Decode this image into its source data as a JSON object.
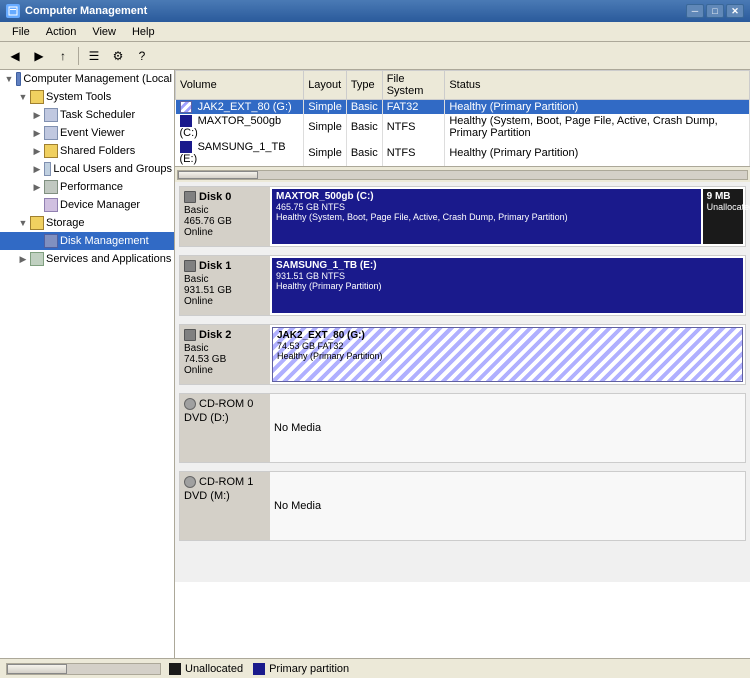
{
  "titleBar": {
    "title": "Computer Management",
    "windowControls": [
      "_",
      "□",
      "✕"
    ]
  },
  "menuBar": {
    "items": [
      "File",
      "Action",
      "View",
      "Help"
    ]
  },
  "sidebar": {
    "root": "Computer Management (Local",
    "items": [
      {
        "id": "system-tools",
        "label": "System Tools",
        "indent": 1,
        "expanded": true
      },
      {
        "id": "task-scheduler",
        "label": "Task Scheduler",
        "indent": 2
      },
      {
        "id": "event-viewer",
        "label": "Event Viewer",
        "indent": 2
      },
      {
        "id": "shared-folders",
        "label": "Shared Folders",
        "indent": 2
      },
      {
        "id": "local-users",
        "label": "Local Users and Groups",
        "indent": 2
      },
      {
        "id": "performance",
        "label": "Performance",
        "indent": 2
      },
      {
        "id": "device-manager",
        "label": "Device Manager",
        "indent": 2
      },
      {
        "id": "storage",
        "label": "Storage",
        "indent": 1,
        "expanded": true
      },
      {
        "id": "disk-management",
        "label": "Disk Management",
        "indent": 2,
        "selected": true
      },
      {
        "id": "services",
        "label": "Services and Applications",
        "indent": 1
      }
    ]
  },
  "volumeTable": {
    "columns": [
      "Volume",
      "Layout",
      "Type",
      "File System",
      "Status"
    ],
    "rows": [
      {
        "name": "JAK2_EXT_80 (G:)",
        "layout": "Simple",
        "type": "Basic",
        "fs": "FAT32",
        "status": "Healthy (Primary Partition)",
        "color": "stripe"
      },
      {
        "name": "MAXTOR_500gb (C:)",
        "layout": "Simple",
        "type": "Basic",
        "fs": "NTFS",
        "status": "Healthy (System, Boot, Page File, Active, Crash Dump, Primary Partition",
        "color": "blue"
      },
      {
        "name": "SAMSUNG_1_TB (E:)",
        "layout": "Simple",
        "type": "Basic",
        "fs": "NTFS",
        "status": "Healthy (Primary Partition)",
        "color": "blue"
      }
    ]
  },
  "disks": [
    {
      "id": "disk0",
      "name": "Disk 0",
      "type": "Basic",
      "size": "465.76 GB",
      "status": "Online",
      "partitions": [
        {
          "name": "MAXTOR_500gb (C:)",
          "size": "465.75 GB NTFS",
          "detail": "Healthy (System, Boot, Page File, Active, Crash Dump, Primary Partition)",
          "style": "primary",
          "flex": 13
        },
        {
          "name": "9 MB",
          "size": "Unallocated",
          "detail": "",
          "style": "unalloc",
          "flex": 1
        }
      ]
    },
    {
      "id": "disk1",
      "name": "Disk 1",
      "type": "Basic",
      "size": "931.51 GB",
      "status": "Online",
      "partitions": [
        {
          "name": "SAMSUNG_1_TB (E:)",
          "size": "931.51 GB NTFS",
          "detail": "Healthy (Primary Partition)",
          "style": "primary",
          "flex": 1
        }
      ]
    },
    {
      "id": "disk2",
      "name": "Disk 2",
      "type": "Basic",
      "size": "74.53 GB",
      "status": "Online",
      "partitions": [
        {
          "name": "JAK2_EXT_80 (G:)",
          "size": "74.53 GB FAT32",
          "detail": "Healthy (Primary Partition)",
          "style": "stripe",
          "flex": 1
        }
      ]
    }
  ],
  "cdroms": [
    {
      "id": "cdrom0",
      "name": "CD-ROM 0",
      "drive": "DVD (D:)",
      "status": "No Media"
    },
    {
      "id": "cdrom1",
      "name": "CD-ROM 1",
      "drive": "DVD (M:)",
      "status": "No Media"
    }
  ],
  "statusBar": {
    "legend": [
      {
        "label": "Unallocated",
        "color": "#1a1a1a"
      },
      {
        "label": "Primary partition",
        "color": "#1a1a8c"
      }
    ]
  }
}
